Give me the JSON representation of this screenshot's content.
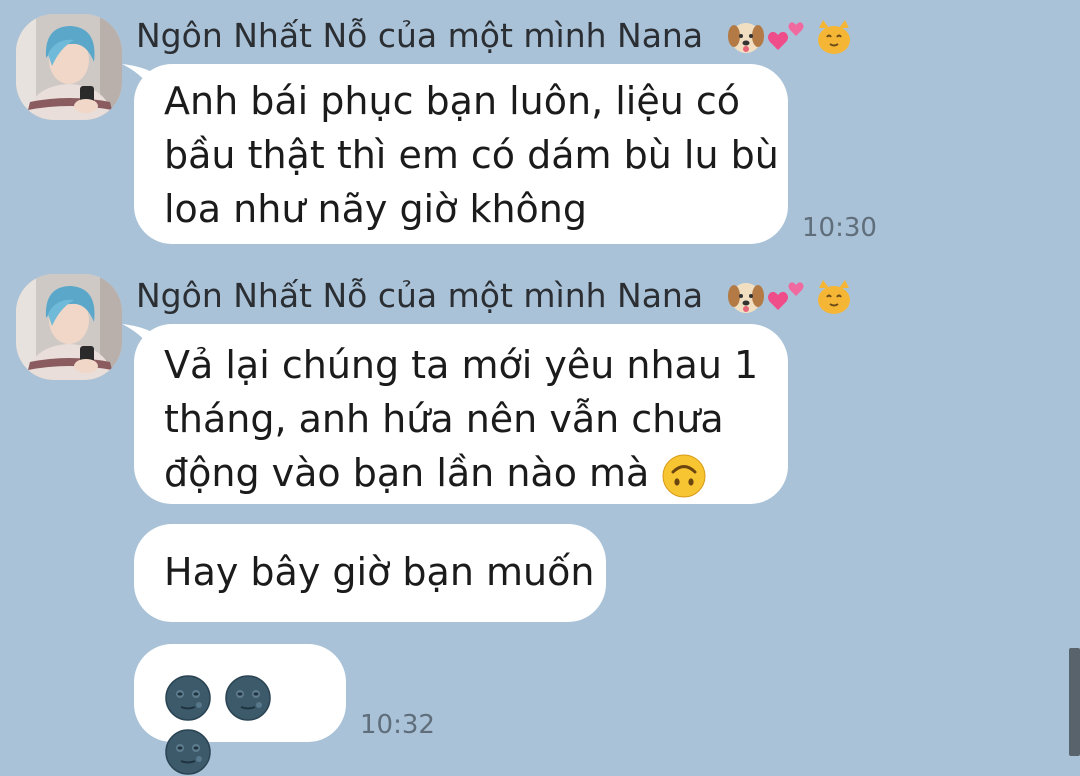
{
  "messages": [
    {
      "sender": "Ngôn Nhất Nỗ của một mình Nana",
      "lines": [
        "Anh bái phục bạn luôn, liệu có",
        "bầu thật thì em có dám bù lu bù",
        "loa như nãy giờ không"
      ],
      "time": "10:30"
    },
    {
      "sender": "Ngôn Nhất Nỗ của một mình Nana",
      "lines": [
        "Vả lại chúng ta mới yêu nhau 1",
        "tháng, anh hứa nên vẫn chưa",
        "động vào bạn lần nào mà"
      ],
      "followups": [
        "Hay bây giờ bạn muốn"
      ],
      "time": "10:32"
    }
  ],
  "sender_emoji_icons": [
    "dog-face-icon",
    "two-hearts-icon",
    "cat-face-icon"
  ],
  "inline_emoji_icons": [
    "upside-down-face-icon",
    "new-moon-face-icon"
  ],
  "colors": {
    "background": "#a9c2d8",
    "bubble": "#ffffff",
    "time": "#5f6e7a"
  }
}
